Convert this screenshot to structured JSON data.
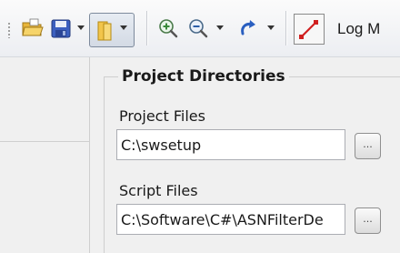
{
  "toolbar": {
    "log_label": "Log M",
    "icons": [
      "open-folder-icon",
      "save-icon",
      "directories-icon",
      "zoom-in-icon",
      "zoom-out-icon",
      "redo-icon",
      "pen-tool-icon"
    ]
  },
  "project_directories": {
    "title": "Project Directories",
    "project_files_label": "Project Files",
    "project_files_value": "C:\\swsetup",
    "script_files_label": "Script Files",
    "script_files_value": "C:\\Software\\C#\\ASNFilterDe",
    "browse_label": "..."
  }
}
